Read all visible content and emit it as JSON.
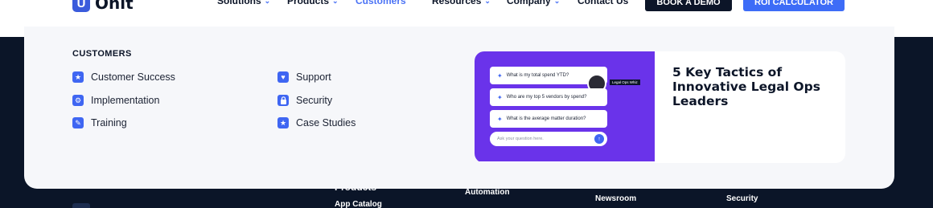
{
  "nav": {
    "logo_mark": "U",
    "logo_text": "Onit",
    "items": [
      {
        "label": "Solutions",
        "chevron": "⌄"
      },
      {
        "label": "Products",
        "chevron": "⌄"
      },
      {
        "label": "Customers",
        "chevron": "⌃"
      },
      {
        "label": "Resources",
        "chevron": "⌄"
      },
      {
        "label": "Company",
        "chevron": "⌄"
      },
      {
        "label": "Contact Us"
      }
    ],
    "active_item": "Customers",
    "demo_button": "BOOK A DEMO",
    "roi_button": "ROI CALCULATOR"
  },
  "mega_menu": {
    "section_title": "CUSTOMERS",
    "links": [
      {
        "label": "Customer Success",
        "icon": "star-icon",
        "glyph": "★"
      },
      {
        "label": "Implementation",
        "icon": "gear-icon",
        "glyph": "⚙"
      },
      {
        "label": "Training",
        "icon": "pencil-icon",
        "glyph": "✎"
      },
      {
        "label": "Support",
        "icon": "heart-icon",
        "glyph": "♥"
      },
      {
        "label": "Security",
        "icon": "lock-icon",
        "glyph": "🔒"
      },
      {
        "label": "Case Studies",
        "icon": "star-icon",
        "glyph": "★"
      }
    ],
    "promo": {
      "title": "5 Key Tactics of Innovative Legal Ops Leaders",
      "chat_prompts": [
        "What is my total spend YTD?",
        "Who are my top 5 vendors by spend?",
        "What is the average matter duration?"
      ],
      "ask_placeholder": "Ask your question here.",
      "avatar_tag": "Legal Ops Whiz",
      "ask_button": "↑"
    }
  },
  "footer_peek": {
    "products_heading": "Products",
    "app_catalog": "App Catalog",
    "automation": "Automation",
    "newsroom": "Newsroom",
    "security": "Security"
  },
  "colors": {
    "accent": "#3f66f2",
    "dark": "#0b1528",
    "promo_bg": "#6a33ea",
    "panel": "#f6f7fa"
  }
}
